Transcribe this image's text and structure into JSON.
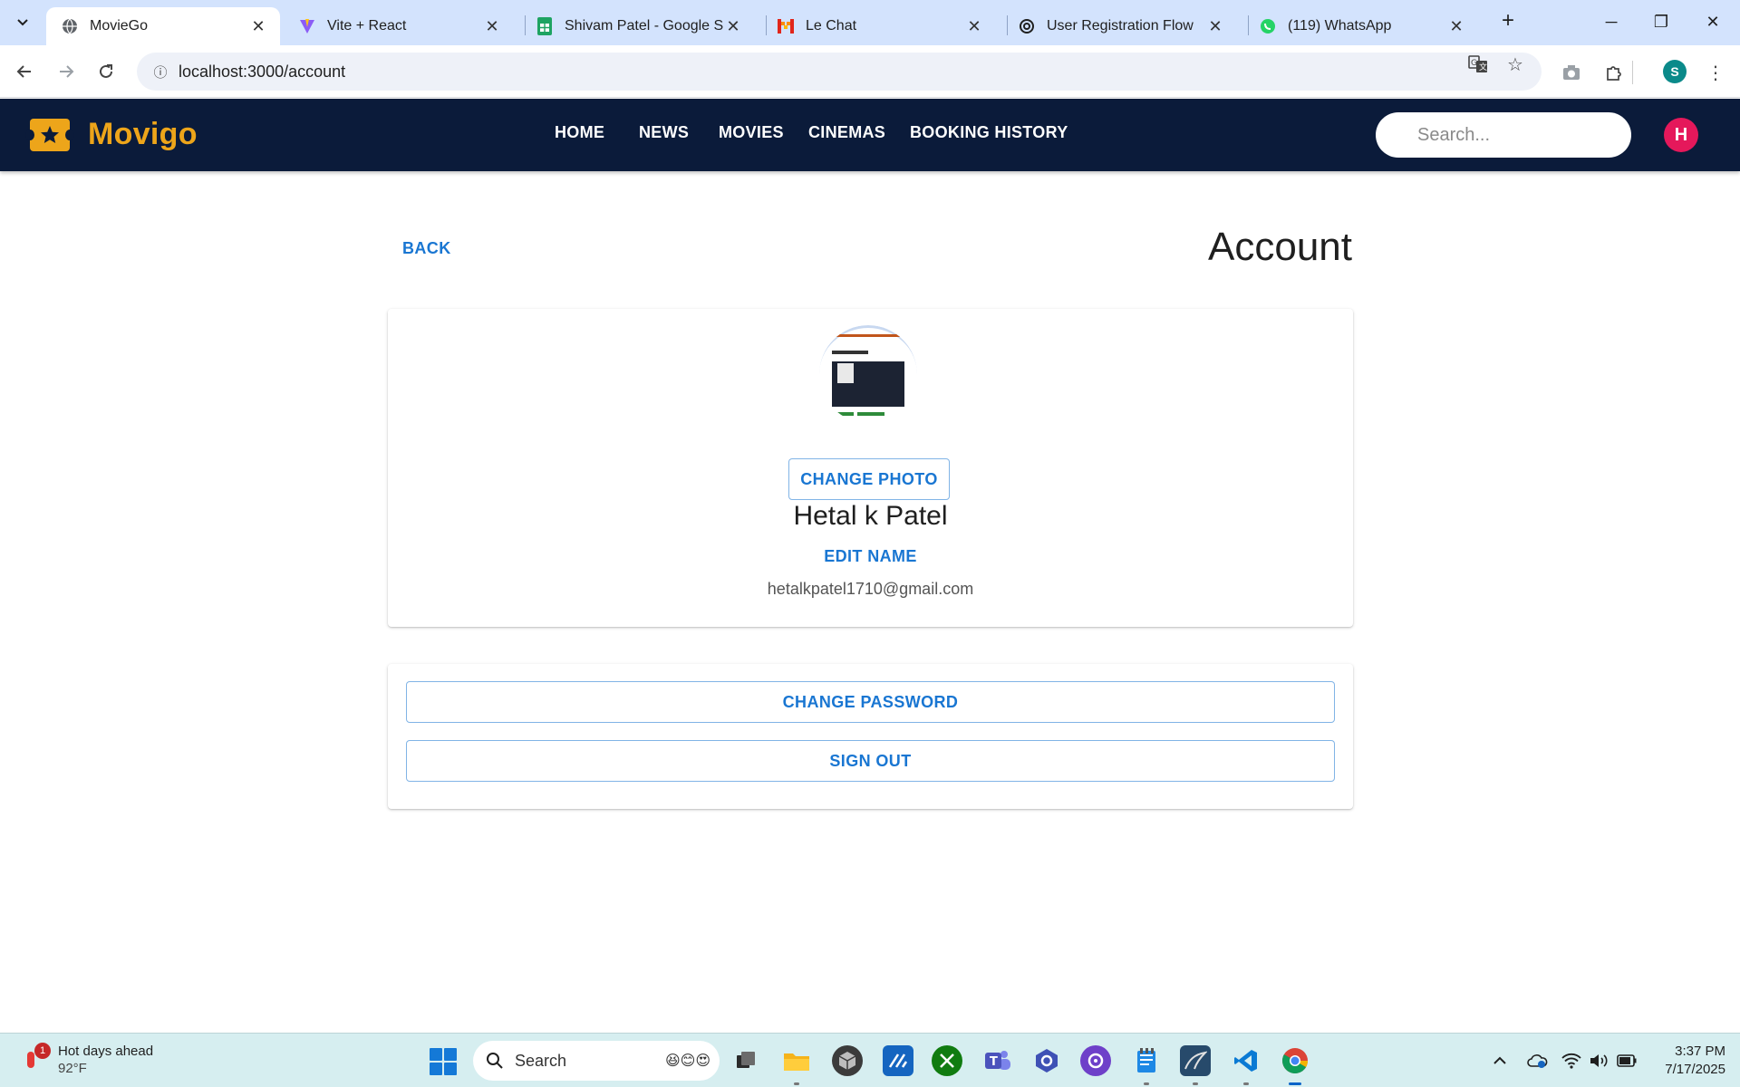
{
  "browser": {
    "tabs": [
      {
        "title": "MovieGo",
        "favicon": "globe-icon",
        "active": true
      },
      {
        "title": "Vite + React",
        "favicon": "vite-icon",
        "active": false
      },
      {
        "title": "Shivam Patel - Google Sheets",
        "favicon": "sheets-icon",
        "active": false
      },
      {
        "title": "Le Chat",
        "favicon": "mistral-icon",
        "active": false
      },
      {
        "title": "User Registration Flow",
        "favicon": "openai-icon",
        "active": false
      },
      {
        "title": "(119) WhatsApp",
        "favicon": "whatsapp-icon",
        "active": false
      }
    ],
    "url": "localhost:3000/account",
    "profile_initial": "S"
  },
  "app": {
    "brand": "Movigo",
    "nav": [
      "HOME",
      "NEWS",
      "MOVIES",
      "CINEMAS",
      "BOOKING HISTORY"
    ],
    "search_placeholder": "Search...",
    "user_initial": "H",
    "colors": {
      "header_bg": "#0b1b3a",
      "brand": "#eda51a",
      "accent": "#1976d2",
      "avatar": "#e5185b"
    }
  },
  "account": {
    "back_label": "BACK",
    "title": "Account",
    "change_photo_label": "CHANGE PHOTO",
    "name": "Hetal k Patel",
    "edit_name_label": "EDIT NAME",
    "email": "hetalkpatel1710@gmail.com",
    "change_password_label": "CHANGE PASSWORD",
    "sign_out_label": "SIGN OUT"
  },
  "taskbar": {
    "weather_alert_count": "1",
    "weather_title": "Hot days ahead",
    "weather_temp": "92°F",
    "search_label": "Search",
    "time": "3:37 PM",
    "date": "7/17/2025"
  }
}
